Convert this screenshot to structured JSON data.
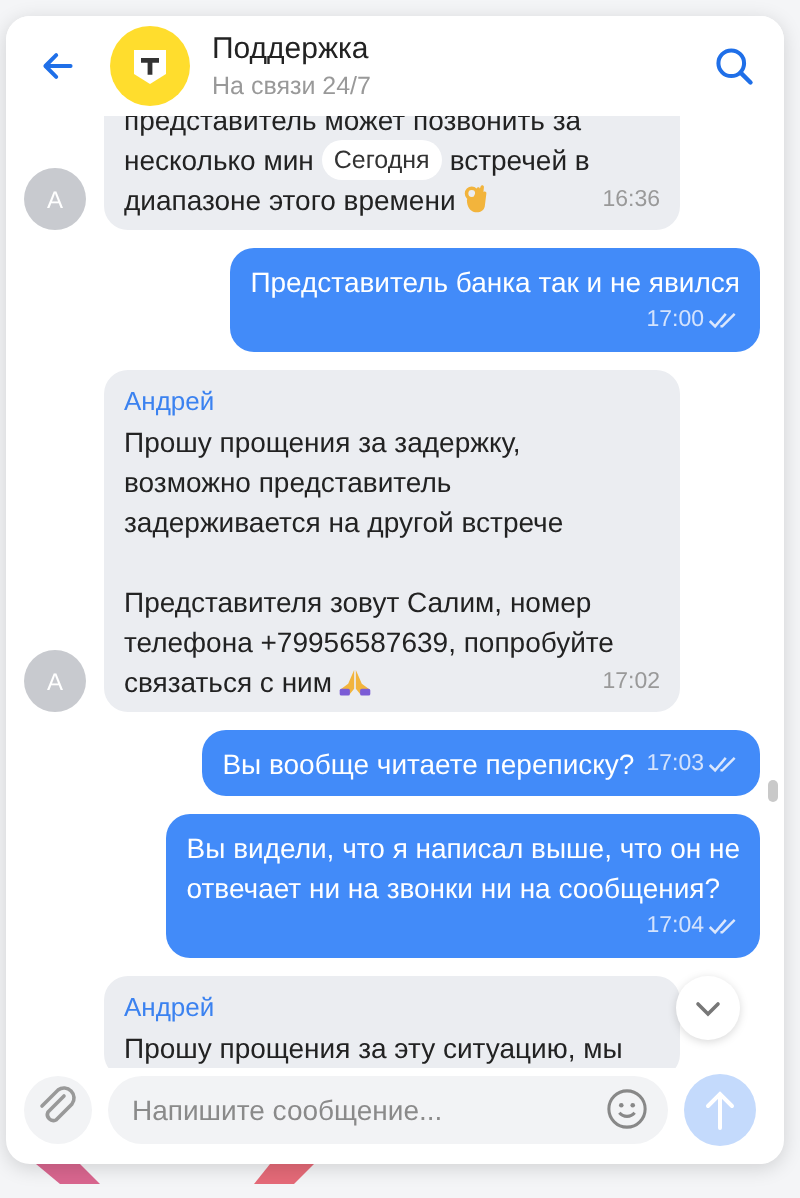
{
  "header": {
    "title": "Поддержка",
    "subtitle": "На связи 24/7"
  },
  "date_divider": {
    "label": "Сегодня"
  },
  "messages": [
    {
      "kind": "incoming",
      "avatar": "А",
      "paragraphs": [
        [
          "представитель может позвонить за",
          {
            "kind": "with_divider",
            "left": "несколько мин",
            "right": "встречей в"
          },
          {
            "kind": "ok_hand",
            "text": "диапазоне этого времени"
          }
        ]
      ],
      "time": "16:36"
    },
    {
      "kind": "outgoing",
      "inline_time": false,
      "paragraphs": [
        [
          "Представитель банка так и не явился"
        ]
      ],
      "time": "17:00",
      "read": true
    },
    {
      "kind": "incoming",
      "author": "Андрей",
      "avatar": "А",
      "paragraphs": [
        [
          "Прошу прощения за задержку,",
          "возможно представитель",
          "задерживается на другой встрече"
        ],
        [
          "Представителя зовут Салим, номер",
          "телефона +79956587639, попробуйте",
          {
            "kind": "praying_hands",
            "text": "связаться с ним"
          }
        ]
      ],
      "time": "17:02"
    },
    {
      "kind": "outgoing",
      "inline_time": true,
      "paragraphs": [
        [
          "Вы вообще читаете переписку?"
        ]
      ],
      "time": "17:03",
      "read": true
    },
    {
      "kind": "outgoing",
      "inline_time": false,
      "paragraphs": [
        [
          "Вы видели, что я написал выше, что он не",
          "отвечает ни на звонки ни на сообщения?"
        ]
      ],
      "time": "17:04",
      "read": true
    },
    {
      "kind": "incoming",
      "author": "Андрей",
      "paragraphs": [
        [
          "Прошу прощения за эту ситуацию, мы"
        ]
      ]
    }
  ],
  "composer": {
    "placeholder": "Напишите сообщение..."
  }
}
